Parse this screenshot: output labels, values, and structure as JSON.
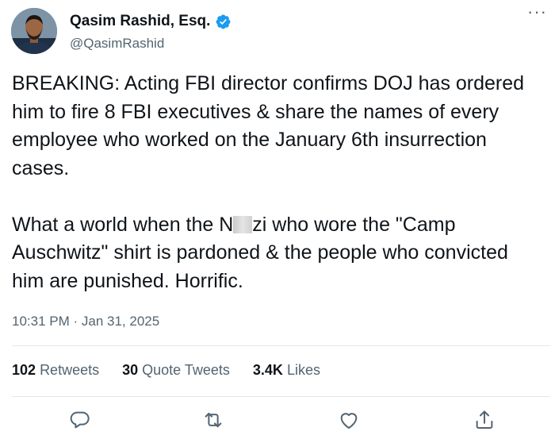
{
  "user": {
    "display_name": "Qasim Rashid, Esq.",
    "handle": "@QasimRashid",
    "verified": true
  },
  "tweet": {
    "para1": "BREAKING: Acting FBI director confirms DOJ has ordered him to fire 8 FBI executives & share the names of every employee who worked on the January 6th insurrection cases.",
    "para2_before": "What a world when the N",
    "para2_after": "zi who wore the \"Camp Auschwitz\" shirt is pardoned & the people who convicted him are punished. Horrific.",
    "timestamp": "10:31 PM · Jan 31, 2025"
  },
  "stats": {
    "retweets_count": "102",
    "retweets_label": "Retweets",
    "quotes_count": "30",
    "quotes_label": "Quote Tweets",
    "likes_count": "3.4K",
    "likes_label": "Likes"
  },
  "icons": {
    "verified": "verified-badge-icon",
    "more": "more-options-icon",
    "reply": "reply-icon",
    "retweet": "retweet-icon",
    "like": "like-icon",
    "share": "share-icon"
  },
  "colors": {
    "verified": "#1d9bf0",
    "secondary_text": "#536471",
    "primary_text": "#0f1419",
    "divider": "#e3e6ea"
  }
}
